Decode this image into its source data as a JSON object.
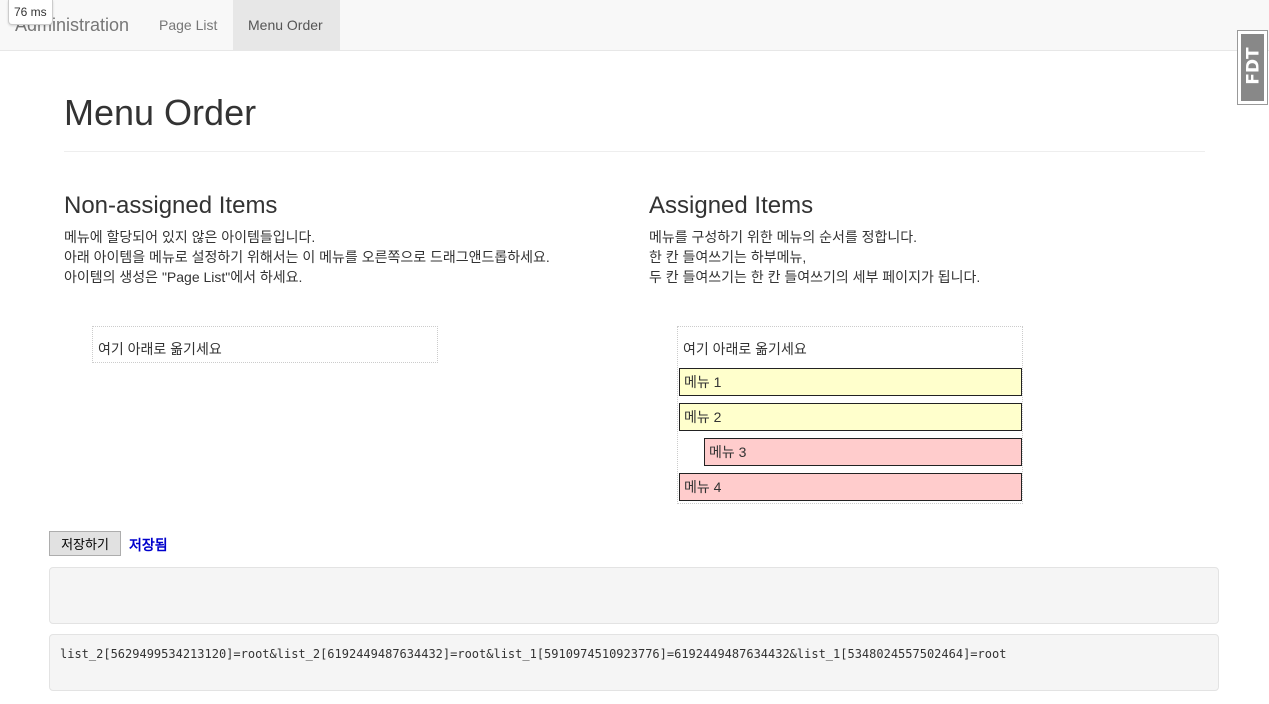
{
  "navbar": {
    "brand": "Administration",
    "links": [
      {
        "label": "Page List",
        "active": false
      },
      {
        "label": "Menu Order",
        "active": true
      }
    ]
  },
  "timer": "76 ms",
  "debug_toolbar": {
    "label": "FDT",
    "icon": "fdt-toolbar-handle"
  },
  "page_title": "Menu Order",
  "non_assigned": {
    "title": "Non-assigned Items",
    "description": [
      "메뉴에 할당되어 있지 않은 아이템들입니다.",
      "아래 아이템을 메뉴로 설정하기 위해서는 이 메뉴를 오른쪽으로 드래그앤드롭하세요.",
      "아이템의 생성은 \"Page List\"에서 하세요."
    ],
    "placeholder": "여기 아래로 옮기세요",
    "items": []
  },
  "assigned": {
    "title": "Assigned Items",
    "description": [
      "메뉴를 구성하기 위한 메뉴의 순서를 정합니다.",
      "한 칸 들여쓰기는 하부메뉴,",
      "두 칸 들여쓰기는 한 칸 들여쓰기의 세부 페이지가 됩니다."
    ],
    "placeholder": "여기 아래로 옮기세요",
    "items": [
      {
        "label": "메뉴 1",
        "level": 0,
        "color": "#ffffcc"
      },
      {
        "label": "메뉴 2",
        "level": 0,
        "color": "#ffffcc"
      },
      {
        "label": "메뉴 3",
        "level": 1,
        "color": "#ffcccc"
      },
      {
        "label": "메뉴 4",
        "level": 0,
        "color": "#ffcccc"
      }
    ]
  },
  "save_button": "저장하기",
  "save_status": "저장됨",
  "output_box": "",
  "serialized": "list_2[5629499534213120]=root&list_2[6192449487634432]=root&list_1[5910974510923776]=6192449487634432&list_1[5348024557502464]=root"
}
